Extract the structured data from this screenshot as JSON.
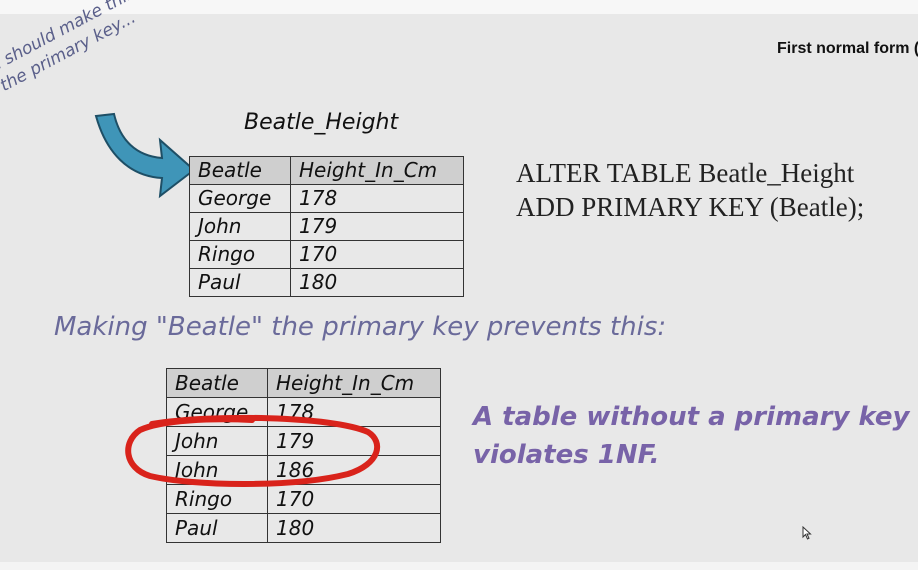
{
  "header": {
    "section_title": "First normal form ("
  },
  "annotation": {
    "line1": "e should make this",
    "line2": "the primary key..."
  },
  "table1": {
    "title": "Beatle_Height",
    "columns": [
      "Beatle",
      "Height_In_Cm"
    ],
    "rows": [
      [
        "George",
        "178"
      ],
      [
        "John",
        "179"
      ],
      [
        "Ringo",
        "170"
      ],
      [
        "Paul",
        "180"
      ]
    ]
  },
  "sql": {
    "line1": "ALTER TABLE Beatle_Height",
    "line2": "ADD PRIMARY KEY (Beatle);"
  },
  "prevents_text": "Making \"Beatle\" the primary key prevents this:",
  "table2": {
    "columns": [
      "Beatle",
      "Height_In_Cm"
    ],
    "rows": [
      [
        "George",
        "178"
      ],
      [
        "John",
        "179"
      ],
      [
        "John",
        "186"
      ],
      [
        "Ringo",
        "170"
      ],
      [
        "Paul",
        "180"
      ]
    ]
  },
  "violates_text": "A table without a primary key violates 1NF.",
  "colors": {
    "arrow": "#3f95b8",
    "highlight_circle": "#d9231b",
    "caption_purple": "#7863a8"
  }
}
